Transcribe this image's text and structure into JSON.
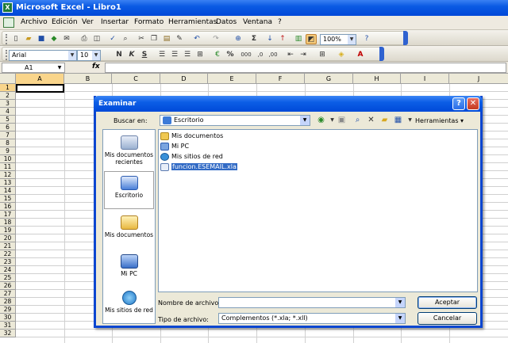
{
  "app": {
    "title": "Microsoft Excel - Libro1",
    "icon": "excel-icon"
  },
  "menu": [
    "Archivo",
    "Edición",
    "Ver",
    "Insertar",
    "Formato",
    "Herramientas",
    "Datos",
    "Ventana",
    "?"
  ],
  "toolbar_standard": {
    "zoom": "100%"
  },
  "toolbar_format": {
    "font": "Arial",
    "size": "10",
    "bold": "N",
    "italic": "K",
    "underline": "S",
    "currency": "€",
    "percent": "%",
    "thousands": "000"
  },
  "formula_bar": {
    "name_box": "A1",
    "fx": "fx",
    "value": ""
  },
  "columns": [
    "A",
    "B",
    "C",
    "D",
    "E",
    "F",
    "G",
    "H",
    "I",
    "J"
  ],
  "rows": [
    "1",
    "2",
    "3",
    "4",
    "5",
    "6",
    "7",
    "8",
    "9",
    "10",
    "11",
    "12",
    "13",
    "14",
    "15",
    "16",
    "17",
    "18",
    "19",
    "20",
    "21",
    "22",
    "23",
    "24",
    "25",
    "26",
    "27",
    "28",
    "29",
    "30",
    "31",
    "32"
  ],
  "dialog": {
    "title": "Examinar",
    "look_in_label": "Buscar en:",
    "look_in_value": "Escritorio",
    "tools_label": "Herramientas",
    "places": [
      {
        "label": "Mis documentos recientes",
        "icon": "recent-documents-icon"
      },
      {
        "label": "Escritorio",
        "icon": "desktop-icon"
      },
      {
        "label": "Mis documentos",
        "icon": "my-documents-icon"
      },
      {
        "label": "Mi PC",
        "icon": "my-computer-icon"
      },
      {
        "label": "Mis sitios de red",
        "icon": "network-places-icon"
      }
    ],
    "files": [
      {
        "name": "Mis documentos",
        "icon": "folder-icon"
      },
      {
        "name": "Mi PC",
        "icon": "computer-icon"
      },
      {
        "name": "Mis sitios de red",
        "icon": "network-icon"
      },
      {
        "name": "funcion.ESEMAIL.xla",
        "icon": "xla-file-icon",
        "selected": true
      }
    ],
    "filename_label": "Nombre de archivo:",
    "filename_value": "",
    "filetype_label": "Tipo de archivo:",
    "filetype_value": "Complementos (*.xla; *.xll)",
    "accept_label": "Aceptar",
    "cancel_label": "Cancelar"
  }
}
